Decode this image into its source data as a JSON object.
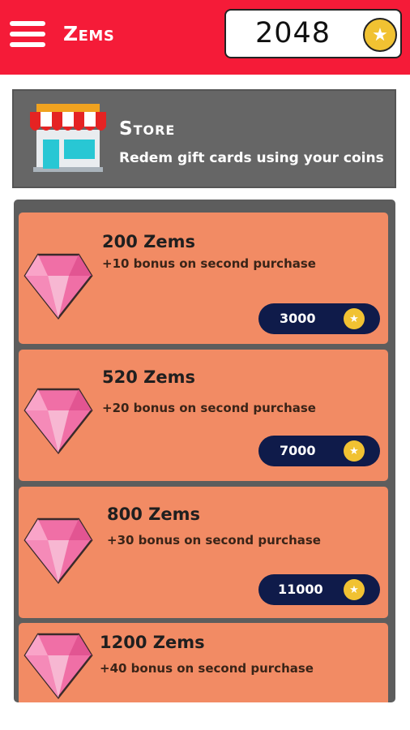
{
  "header": {
    "title": "Zems",
    "coin_balance": "2048",
    "menu_icon": "hamburger-menu-icon",
    "coin_icon": "star-coin-icon",
    "bg_color": "#f51b38"
  },
  "store": {
    "title": "Store",
    "subtitle": "Redem gift cards using your coins",
    "icon": "storefront-icon"
  },
  "offers": [
    {
      "title": "200 Zems",
      "bonus": "+10 bonus on second purchase",
      "price": "3000"
    },
    {
      "title": "520  Zems",
      "bonus": "+20 bonus on second purchase",
      "price": "7000"
    },
    {
      "title": "800 Zems",
      "bonus": "+30 bonus on second purchase",
      "price": "11000"
    },
    {
      "title": "1200 Zems",
      "bonus": "+40 bonus on second purchase",
      "price": ""
    }
  ],
  "colors": {
    "card": "#f28b64",
    "panel": "#5d5d5d",
    "price_pill": "#0f1b4a",
    "coin": "#f1c232",
    "gem": "#f06fa6"
  }
}
